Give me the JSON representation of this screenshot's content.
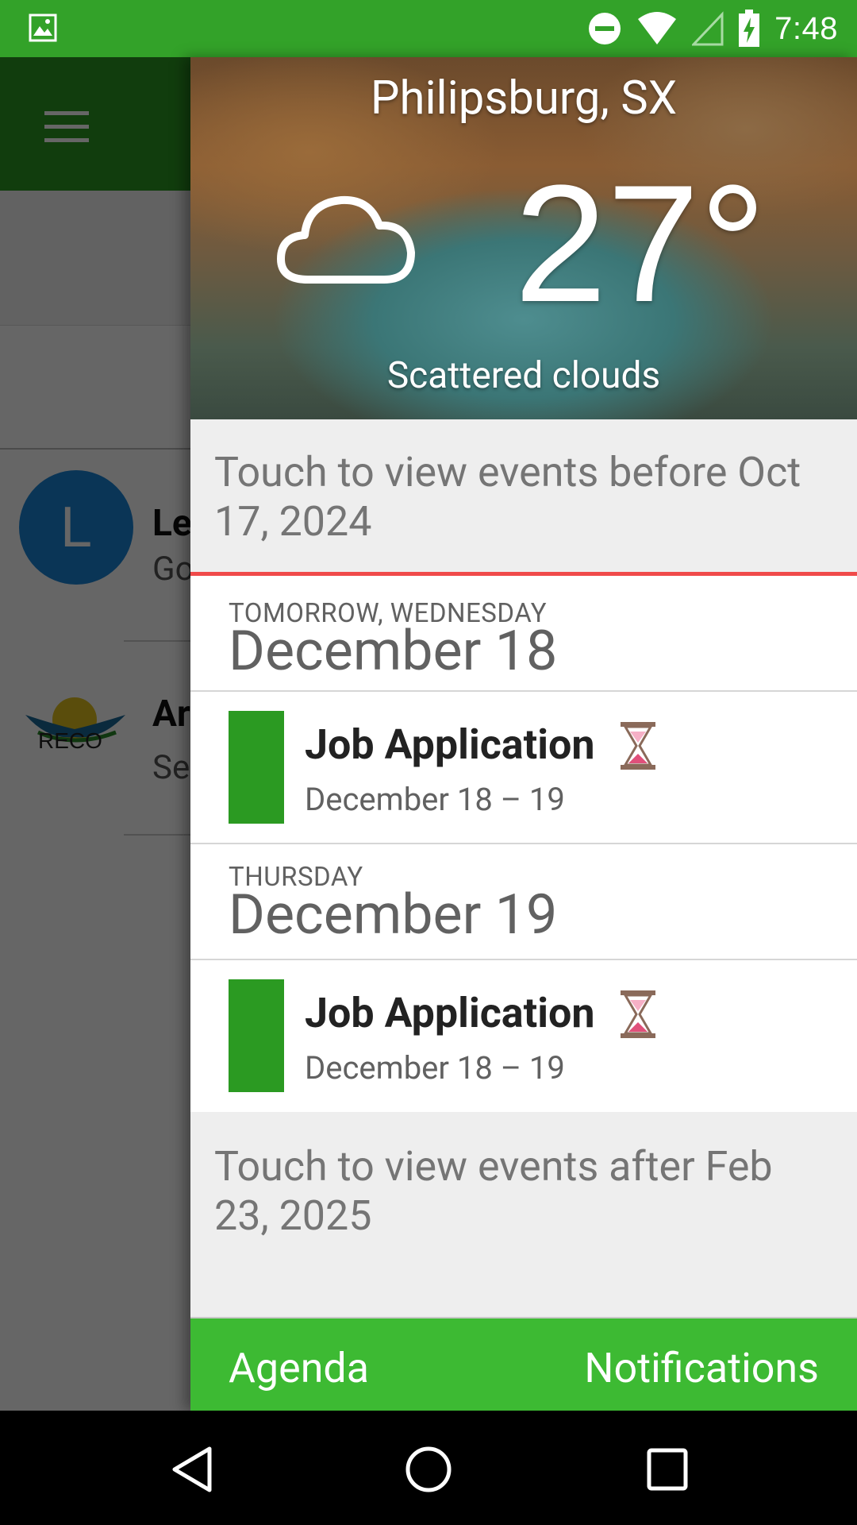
{
  "status_bar": {
    "time": "7:48",
    "icons": [
      "gallery-icon",
      "do-not-disturb-icon",
      "wifi-icon",
      "signal-icon",
      "battery-charging-icon"
    ]
  },
  "background_app": {
    "contact1": {
      "avatar_letter": "L",
      "name": "Le",
      "subtitle": "Go"
    },
    "contact2": {
      "name": "Ar",
      "subtitle": "Se"
    },
    "accent": "#2b9a22"
  },
  "weather": {
    "city": "Philipsburg, SX",
    "temperature": "27°",
    "description": "Scattered clouds",
    "icon": "cloud-icon"
  },
  "agenda": {
    "touch_before": "Touch to view events before Oct 17, 2024",
    "days": [
      {
        "day_of_week": "TOMORROW, WEDNESDAY",
        "date": "December 18",
        "events": [
          {
            "title": "Job Application",
            "range": "December 18 – 19",
            "color": "#2b9a22",
            "status_icon": "hourglass-icon"
          }
        ]
      },
      {
        "day_of_week": "THURSDAY",
        "date": "December 19",
        "events": [
          {
            "title": "Job Application",
            "range": "December 18 – 19",
            "color": "#2b9a22",
            "status_icon": "hourglass-icon"
          }
        ]
      }
    ],
    "touch_after": "Touch to view events after Feb 23, 2025"
  },
  "tabs": {
    "agenda_label": "Agenda",
    "notifications_label": "Notifications"
  },
  "colors": {
    "status_bar": "#33a229",
    "tab_bar": "#3dba33",
    "now_line": "#f04a4a"
  }
}
